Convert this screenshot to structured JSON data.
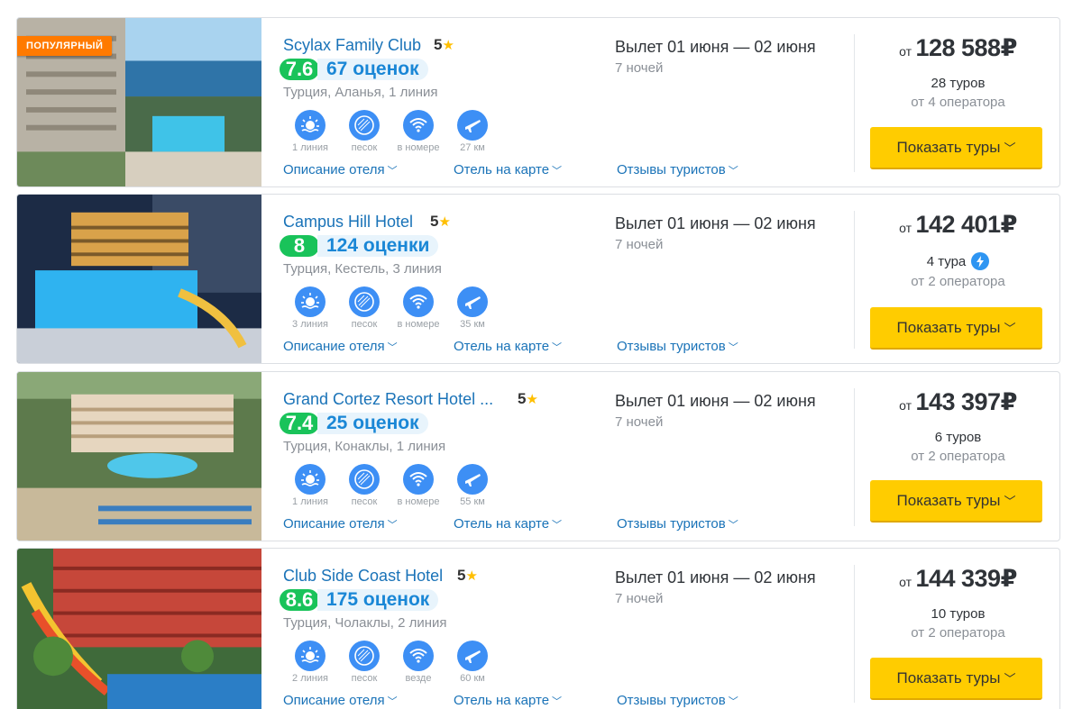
{
  "hotels": [
    {
      "popular_badge": "ПОПУЛЯРНЫЙ",
      "name": "Scylax Family Club",
      "stars": "5",
      "score": "7.6",
      "reviews": "67 оценок",
      "location": "Турция, Аланья, 1 линия",
      "amenities": [
        "1 линия",
        "песок",
        "в номере",
        "27 км"
      ],
      "flight": "Вылет 01 июня — 02 июня",
      "nights": "7 ночей",
      "price_from": "от",
      "price": "128 588₽",
      "tours": "28 туров",
      "operators": "от 4 оператора",
      "has_bolt": false
    },
    {
      "popular_badge": "",
      "name": "Campus Hill Hotel",
      "stars": "5",
      "score": "8",
      "reviews": "124 оценки",
      "location": "Турция, Кестель, 3 линия",
      "amenities": [
        "3 линия",
        "песок",
        "в номере",
        "35 км"
      ],
      "flight": "Вылет 01 июня — 02 июня",
      "nights": "7 ночей",
      "price_from": "от",
      "price": "142 401₽",
      "tours": "4 тура",
      "operators": "от 2 оператора",
      "has_bolt": true
    },
    {
      "popular_badge": "",
      "name": "Grand Cortez Resort Hotel ...",
      "stars": "5",
      "score": "7.4",
      "reviews": "25 оценок",
      "location": "Турция, Конаклы, 1 линия",
      "amenities": [
        "1 линия",
        "песок",
        "в номере",
        "55 км"
      ],
      "flight": "Вылет 01 июня — 02 июня",
      "nights": "7 ночей",
      "price_from": "от",
      "price": "143 397₽",
      "tours": "6 туров",
      "operators": "от 2 оператора",
      "has_bolt": false
    },
    {
      "popular_badge": "",
      "name": "Club Side Coast Hotel",
      "stars": "5",
      "score": "8.6",
      "reviews": "175 оценок",
      "location": "Турция, Чолаклы, 2 линия",
      "amenities": [
        "2 линия",
        "песок",
        "везде",
        "60 км"
      ],
      "flight": "Вылет 01 июня — 02 июня",
      "nights": "7 ночей",
      "price_from": "от",
      "price": "144 339₽",
      "tours": "10 туров",
      "operators": "от 2 оператора",
      "has_bolt": false
    }
  ],
  "links": {
    "description": "Описание отеля",
    "map": "Отель на карте",
    "reviews": "Отзывы туристов"
  },
  "button_label": "Показать туры",
  "colors": {
    "score_green": "#19c35a",
    "link_blue": "#1a73b8",
    "button_yellow": "#ffcc00",
    "popular_orange": "#ff7a00",
    "amenity_blue": "#3d8ff5"
  }
}
